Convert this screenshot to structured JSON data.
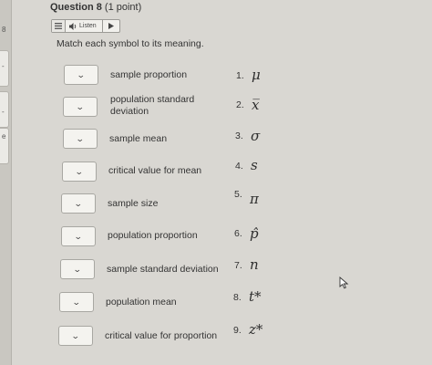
{
  "question": {
    "title": "Question 8",
    "points": "(1 point)"
  },
  "listen": {
    "label": "Listen"
  },
  "instructions": "Match each symbol to its meaning.",
  "rows": [
    {
      "meaning": "sample proportion",
      "num": "1.",
      "symbol": "μ"
    },
    {
      "meaning": "population standard\ndeviation",
      "num": "2.",
      "symbol": "x̅"
    },
    {
      "meaning": "sample mean",
      "num": "3.",
      "symbol": "σ"
    },
    {
      "meaning": "critical value for mean",
      "num": "4.",
      "symbol": "s"
    },
    {
      "meaning": "sample size",
      "num": "5.",
      "symbol": "π"
    },
    {
      "meaning": "population proportion",
      "num": "6.",
      "symbol": "p̂"
    },
    {
      "meaning": "sample standard deviation",
      "num": "7.",
      "symbol": "n"
    },
    {
      "meaning": "population mean",
      "num": "8.",
      "symbol": "t*"
    },
    {
      "meaning": "critical value for proportion",
      "num": "9.",
      "symbol": "z*"
    }
  ],
  "left_marks": [
    "8",
    "-",
    "-",
    "e"
  ]
}
